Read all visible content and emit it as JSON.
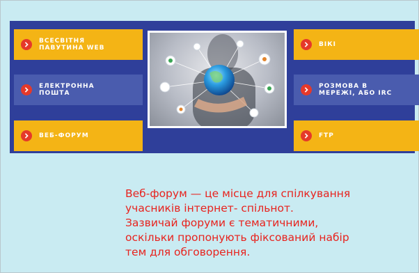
{
  "buttons_left": [
    {
      "label": "ВСЕСВІТНЯ\nПАВУТИНА WEB",
      "style": "yellow"
    },
    {
      "label": "ЕЛЕКТРОННА\nПОШТА",
      "style": "blue"
    },
    {
      "label": "ВЕБ-ФОРУМ",
      "style": "yellow"
    }
  ],
  "buttons_right": [
    {
      "label": "ВІКІ",
      "style": "yellow"
    },
    {
      "label": "РОЗМОВА В\nМЕРЕЖІ, АБО IRC",
      "style": "blue"
    },
    {
      "label": "FTP",
      "style": "yellow"
    }
  ],
  "center_image": {
    "icon": "globe-network-icon"
  },
  "description": "Веб-форум — це місце для спілкування\n учасників інтернет- спільнот.\nЗазвичай форуми є тематичними,\nоскільки пропонують фіксований набір\nтем для обговорення.",
  "colors": {
    "background": "#c9ebf2",
    "banner": "#2f3f9a",
    "yellow_button": "#f4b415",
    "blue_button": "#4a5cae",
    "bullet": "#e5392a",
    "text": "#e8231e"
  }
}
